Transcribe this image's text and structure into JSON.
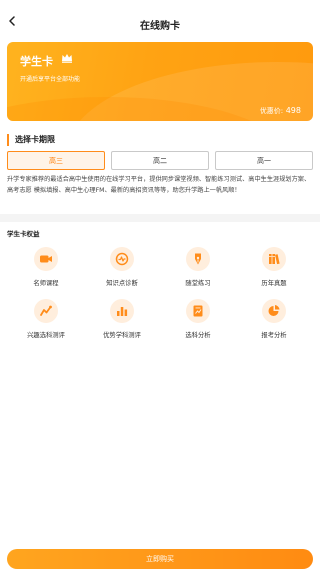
{
  "header": {
    "title": "在线购卡"
  },
  "card": {
    "name": "学生卡",
    "description": "开通后享平台全部功能",
    "price_label": "优惠价:",
    "price_value": "498"
  },
  "period_section": {
    "title": "选择卡期限",
    "options": [
      {
        "label": "高三",
        "selected": true
      },
      {
        "label": "高二",
        "selected": false
      },
      {
        "label": "高一",
        "selected": false
      }
    ]
  },
  "intro": "升学专家推荐的最适合高中生使用的在线学习平台，提供同步课堂视频、智能练习测试、高中生生涯规划方案、高考志愿 模拟填报、高中生心理FM、最新的高招资讯等等，助您升学路上一帆风顺！",
  "benefits": {
    "title": "学生卡权益",
    "items": [
      {
        "label": "名师课程",
        "icon": "video-icon"
      },
      {
        "label": "知识点诊断",
        "icon": "diagnosis-icon"
      },
      {
        "label": "随堂练习",
        "icon": "pen-icon"
      },
      {
        "label": "历年真题",
        "icon": "books-icon"
      },
      {
        "label": "兴趣选科测评",
        "icon": "interest-icon"
      },
      {
        "label": "优势学科测评",
        "icon": "bar-chart-icon"
      },
      {
        "label": "选科分析",
        "icon": "analysis-icon"
      },
      {
        "label": "报考分析",
        "icon": "pie-chart-icon"
      }
    ]
  },
  "buy_button": {
    "label": "立即购买"
  },
  "colors": {
    "accent": "#ff8c1a",
    "card": "#ffa313",
    "icon_bg": "#ffeedd"
  }
}
